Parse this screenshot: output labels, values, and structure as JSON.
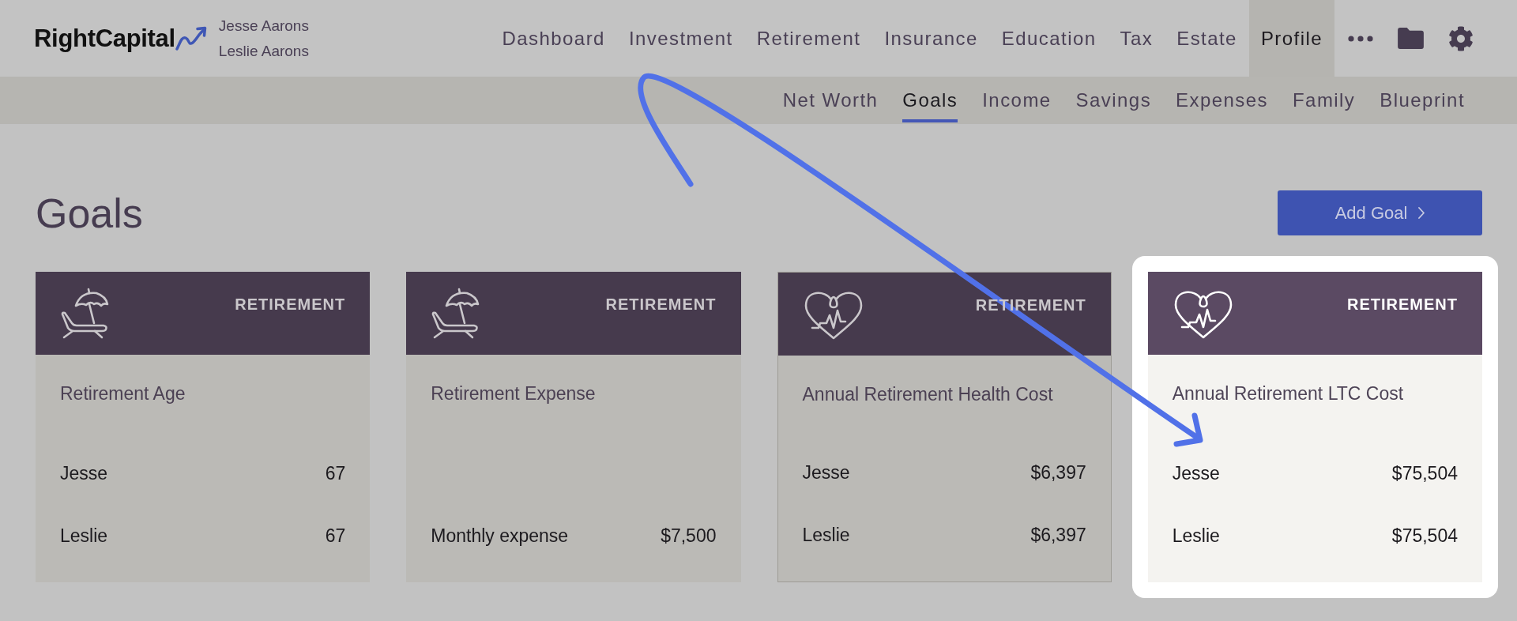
{
  "header": {
    "logo": "RightCapital",
    "users": [
      "Jesse Aarons",
      "Leslie Aarons"
    ],
    "nav": [
      {
        "label": "Dashboard",
        "selected": false
      },
      {
        "label": "Investment",
        "selected": false
      },
      {
        "label": "Retirement",
        "selected": false
      },
      {
        "label": "Insurance",
        "selected": false
      },
      {
        "label": "Education",
        "selected": false
      },
      {
        "label": "Tax",
        "selected": false
      },
      {
        "label": "Estate",
        "selected": false
      },
      {
        "label": "Profile",
        "selected": true
      }
    ]
  },
  "subnav": [
    {
      "label": "Net Worth",
      "selected": false
    },
    {
      "label": "Goals",
      "selected": true
    },
    {
      "label": "Income",
      "selected": false
    },
    {
      "label": "Savings",
      "selected": false
    },
    {
      "label": "Expenses",
      "selected": false
    },
    {
      "label": "Family",
      "selected": false
    },
    {
      "label": "Blueprint",
      "selected": false
    }
  ],
  "page": {
    "title": "Goals",
    "add_button": "Add Goal"
  },
  "goals": [
    {
      "kind": "beach",
      "category": "RETIREMENT",
      "title": "Retirement Age",
      "rows": [
        {
          "label": "Jesse",
          "value": "67"
        },
        {
          "label": "Leslie",
          "value": "67"
        }
      ],
      "outlined": false,
      "highlighted": false
    },
    {
      "kind": "beach",
      "category": "RETIREMENT",
      "title": "Retirement Expense",
      "rows": [
        {
          "label": "Monthly expense",
          "value": "$7,500"
        }
      ],
      "outlined": false,
      "highlighted": false
    },
    {
      "kind": "health",
      "category": "RETIREMENT",
      "title": "Annual Retirement Health Cost",
      "rows": [
        {
          "label": "Jesse",
          "value": "$6,397"
        },
        {
          "label": "Leslie",
          "value": "$6,397"
        }
      ],
      "outlined": true,
      "highlighted": false
    },
    {
      "kind": "health",
      "category": "RETIREMENT",
      "title": "Annual Retirement LTC Cost",
      "rows": [
        {
          "label": "Jesse",
          "value": "$75,504"
        },
        {
          "label": "Leslie",
          "value": "$75,504"
        }
      ],
      "outlined": false,
      "highlighted": true
    }
  ]
}
